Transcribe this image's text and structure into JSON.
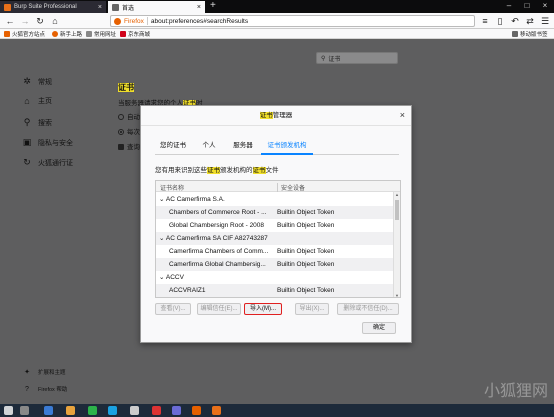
{
  "tabs": [
    {
      "title": "Burp Suite Professional",
      "fav_color": "#e8701a"
    },
    {
      "title": "首选",
      "fav_color": "#666666"
    }
  ],
  "nav": {
    "brand": "Firefox",
    "url": "about:preferences#searchResults"
  },
  "bookmarks": [
    {
      "label": "火狐官方站点",
      "fav_color": "#e66000"
    },
    {
      "label": "新手上路",
      "fav_color": "#e66000"
    },
    {
      "label": "常用网址",
      "fav_color": "#888888"
    },
    {
      "label": "京东商城",
      "fav_color": "#d0021b"
    },
    {
      "label": "移动版书签",
      "fav_color": "#666666"
    }
  ],
  "search": {
    "value": "证书"
  },
  "sidebar": [
    {
      "label": "常规",
      "icon": "gear-icon"
    },
    {
      "label": "主页",
      "icon": "home-icon"
    },
    {
      "label": "搜索",
      "icon": "search-icon"
    },
    {
      "label": "隐私与安全",
      "icon": "lock-icon"
    },
    {
      "label": "火狐通行证",
      "icon": "sync-icon"
    }
  ],
  "sidebar_bottom": [
    {
      "label": "扩展和主题",
      "icon": "puzzle-icon"
    },
    {
      "label": "Firefox 帮助",
      "icon": "help-icon"
    }
  ],
  "content": {
    "heading": "证书",
    "text_a": "当服务器请求您的个人",
    "text_hl": "证书",
    "text_b": "时",
    "r1": "自动",
    "r2": "每次",
    "c1": "查询"
  },
  "dialog": {
    "title_hl": "证书",
    "title_rest": "管理器",
    "tabs": [
      "您的证书",
      "个人",
      "服务器",
      "证书颁发机构"
    ],
    "active_tab": 3,
    "desc_a": "您有用来识别这些",
    "desc_hl1": "证书",
    "desc_b": "颁发机构的",
    "desc_hl2": "证书",
    "desc_c": "文件",
    "col_name": "证书名称",
    "col_device": "安全设备",
    "rows": [
      {
        "name": "AC Camerfirma S.A.",
        "device": "",
        "group": true
      },
      {
        "name": "Chambers of Commerce Root - ...",
        "device": "Builtin Object Token",
        "group": false
      },
      {
        "name": "Global Chambersign Root - 2008",
        "device": "Builtin Object Token",
        "group": false
      },
      {
        "name": "AC Camerfirma SA CIF A82743287",
        "device": "",
        "group": true
      },
      {
        "name": "Camerfirma Chambers of Comm...",
        "device": "Builtin Object Token",
        "group": false
      },
      {
        "name": "Camerfirma Global Chambersig...",
        "device": "Builtin Object Token",
        "group": false
      },
      {
        "name": "ACCV",
        "device": "",
        "group": true
      },
      {
        "name": "ACCVRAIZ1",
        "device": "Builtin Object Token",
        "group": false
      }
    ],
    "buttons": {
      "view": "查看(V)...",
      "edit": "编辑信任(E)...",
      "import": "导入(M)...",
      "export": "导出(X)...",
      "delete": "删除或不信任(D)...",
      "ok": "确定"
    }
  },
  "watermark": "小狐狸网",
  "colors": {
    "highlight": "#f0de2a",
    "accent": "#0a84ff",
    "import_border": "#e02020"
  }
}
